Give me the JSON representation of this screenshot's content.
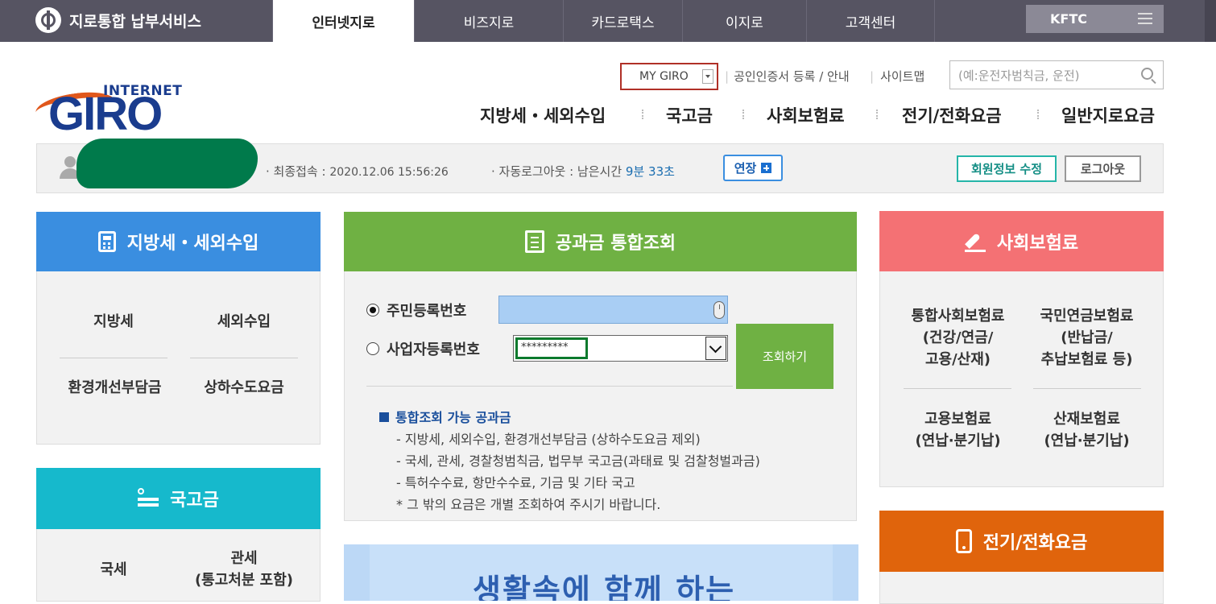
{
  "topbar": {
    "brand": "지로통합 납부서비스",
    "tabs": [
      "인터넷지로",
      "비즈지로",
      "카드로택스",
      "이지로",
      "고객센터"
    ],
    "kftc": "KFTC"
  },
  "util": {
    "mygiro": "MY GIRO",
    "cert": "공인인증서 등록 / 안내",
    "sitemap": "사이트맵",
    "search_placeholder": "(예:운전자범칙금, 운전)"
  },
  "logo": {
    "internet": "INTERNET",
    "giro": "GIRO"
  },
  "mainmenu": [
    "지방세・세외수입",
    "국고금",
    "사회보험료",
    "전기/전화요금",
    "일반지로요금"
  ],
  "infobar": {
    "last_login_label": "· 최종접속 :",
    "last_login_value": "2020.12.06 15:56:26",
    "auto_logout_label": "· 자동로그아웃 : 남은시간",
    "remaining": "9분 33초",
    "extend": "연장",
    "edit_member": "회원정보 수정",
    "logout": "로그아웃"
  },
  "local_tax": {
    "title": "지방세・세외수입",
    "items": [
      "지방세",
      "세외수입",
      "환경개선부담금",
      "상하수도요금"
    ]
  },
  "national": {
    "title": "국고금",
    "items": [
      "국세",
      "관세\n(통고처분 포함)"
    ]
  },
  "lookup": {
    "title": "공과금 통합조회",
    "radio_ssn": "주민등록번호",
    "radio_biz": "사업자등록번호",
    "biz_value": "*********",
    "button": "조회하기",
    "notice_title": "통합조회 가능 공과금",
    "notes": [
      "- 지방세, 세외수입, 환경개선부담금 (상하수도요금 제외)",
      "- 국세, 관세, 경찰청범칙금, 법무부 국고금(과태료 및 검찰청벌과금)",
      "- 특허수수료, 항만수수료, 기금 및 기타 국고",
      "* 그 밖의 요금은 개별 조회하여 주시기 바랍니다."
    ]
  },
  "banner": {
    "text": "생활속에 함께 하는"
  },
  "social": {
    "title": "사회보험료",
    "items": [
      "통합사회보험료\n(건강/연금/\n고용/산재)",
      "국민연금보험료\n(반납금/\n추납보험료 등)",
      "고용보험료\n(연납·분기납)",
      "산재보험료\n(연납·분기납)"
    ]
  },
  "electric": {
    "title": "전기/전화요금"
  },
  "colors": {
    "topbar": "#565462",
    "local_tax": "#3a8ee0",
    "national": "#16b9cc",
    "lookup": "#6fb143",
    "social": "#f47174",
    "electric": "#e0640c"
  }
}
